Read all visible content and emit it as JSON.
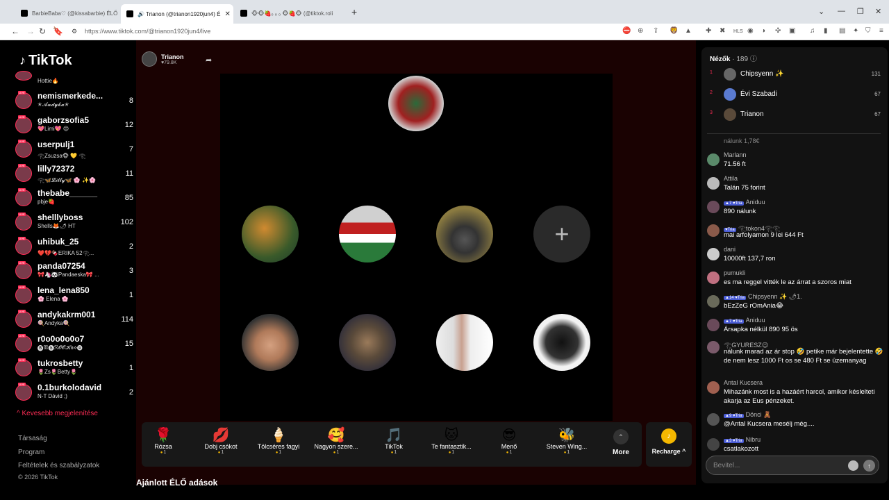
{
  "browser": {
    "tabs": [
      {
        "title": "BarbieBaba♡ (@kissabarbie) ÉLŐ adá"
      },
      {
        "title": "🔊 Trianon (@trianon1920jun4) É"
      },
      {
        "title": "🐵🐵🍓ₒ ₒ ₒ 🐵🍓🐵 (@tiktok.roli"
      }
    ],
    "url": "https://www.tiktok.com/@trianon1920jun4/live"
  },
  "sidebar": {
    "logo": "TikTok",
    "top_sub": "Hottie🔥",
    "following": [
      {
        "name": "nemismerkede...",
        "sub": "✭𝓐𝓷𝓭𝔂𝓴𝓪✭",
        "count": "8"
      },
      {
        "name": "gaborzsofia5",
        "sub": "💖Limi💖 😍",
        "count": "12"
      },
      {
        "name": "userpulj1",
        "sub": "𓂀Zsuzsa🐵 💛 𓂀",
        "count": "7"
      },
      {
        "name": "lilly72372",
        "sub": "𓂀🦋𝓛𝓲𝓵𝓵𝔂🦋 🌸 ✨🌸",
        "count": "11"
      },
      {
        "name": "thebabe______",
        "sub": "pbje🍓",
        "count": "85"
      },
      {
        "name": "shelllyboss",
        "sub": "Shells🦊🌶 HT",
        "count": "102"
      },
      {
        "name": "uhibuk_25",
        "sub": "❤️💔🍫ERIKA 52𓂀...",
        "count": "2"
      },
      {
        "name": "panda07254",
        "sub": "🎀🦄🐼Pandaeska🎀 ...",
        "count": "3"
      },
      {
        "name": "lena_lena850",
        "sub": "🌸 Elena 🌸",
        "count": "1"
      },
      {
        "name": "andykakrm001",
        "sub": "🍭Andyka🍭",
        "count": "114"
      },
      {
        "name": "r0o0o0o0o7",
        "sub": "🅑ꕥ🅢ℛ𝓞𝓞𝓚ɞ⟡🅑",
        "count": "15"
      },
      {
        "name": "tukrosbetty",
        "sub": "🌷Zs🌷Betty🌷",
        "count": "1"
      },
      {
        "name": "0.1burkolodavid",
        "sub": "N-T Dávid ;)",
        "count": "2"
      }
    ],
    "show_less": "^ Kevesebb megjelenítése",
    "footer": [
      "Társaság",
      "Program",
      "Feltételek és szabályzatok",
      "© 2026 TikTok"
    ]
  },
  "stream": {
    "host_name": "Trianon",
    "host_likes": "♥79.8K",
    "suggested_heading": "Ajánlott ÉLŐ adások"
  },
  "gifts": [
    {
      "name": "Rózsa",
      "price": "1",
      "icon": "🌹"
    },
    {
      "name": "Dobj csókot",
      "price": "1",
      "icon": "💋"
    },
    {
      "name": "Tölcséres fagyi",
      "price": "1",
      "icon": "🍦"
    },
    {
      "name": "Nagyon szere...",
      "price": "1",
      "icon": "🥰"
    },
    {
      "name": "TikTok",
      "price": "1",
      "icon": "🎵"
    },
    {
      "name": "Te fantasztik...",
      "price": "1",
      "icon": "🐱"
    },
    {
      "name": "Menő",
      "price": "1",
      "icon": "😎"
    },
    {
      "name": "Steven Wing...",
      "price": "1",
      "icon": "🐝"
    }
  ],
  "more_label": "More",
  "recharge_label": "Recharge ^",
  "chat": {
    "viewers_label": "Nézők",
    "viewer_count": "· 189",
    "top_viewers": [
      {
        "rank": "1",
        "name": "Chipsyenn ✨",
        "score": "131"
      },
      {
        "rank": "2",
        "name": "Évi Szabadi",
        "score": "67"
      },
      {
        "rank": "3",
        "name": "Trianon",
        "score": "67"
      }
    ],
    "partial": "nálunk 1,78€",
    "messages": [
      {
        "badges": "",
        "name": "Marlann",
        "text": "71.56 ft"
      },
      {
        "badges": "",
        "name": "Attila",
        "text": "Talán 75 forint"
      },
      {
        "badges": "▲7 ♥Tria",
        "name": "Aniduu",
        "text": "890 nálunk"
      },
      {
        "badges": "♥Tria",
        "name": "𓂀tokon4𓂀𓂀",
        "text": "mai arfolyamon 9 lei 644 Ft"
      },
      {
        "badges": "",
        "name": "dani",
        "text": "10000ft 137,7 ron"
      },
      {
        "badges": "",
        "name": "pumukli",
        "text": "es ma reggel vitték le az árrat a szoros miat"
      },
      {
        "badges": "▲14 ♥Tria",
        "name": "Chipsyenn ✨ 🌶1.",
        "text": "bEzZeG rOmAnia😂"
      },
      {
        "badges": "▲7 ♥Tria",
        "name": "Aniduu",
        "text": "Ársapka nélkül 890 95 ös"
      },
      {
        "badges": "",
        "name": "𓂀GYURESZ😉",
        "text": "nálunk marad az ár stop 🤣 petike már bejelentette 🤣 de nem lesz 1000 Ft os se 480 Ft se üzemanyag"
      },
      {
        "badges": "",
        "name": "Antal Kucsera",
        "text": "Mihazánk most is a hazáért harcol, amikor késlelteti akarja az Eus pénzeket."
      },
      {
        "badges": "▲9 ♥Tria",
        "name": "Dönci 🧸",
        "text": "@Antal Kucsera mesélj még...."
      },
      {
        "badges": "▲3 ♥Tria",
        "name": "Nibru",
        "text": "csatlakozott"
      }
    ],
    "input_placeholder": "Bevitel..."
  }
}
